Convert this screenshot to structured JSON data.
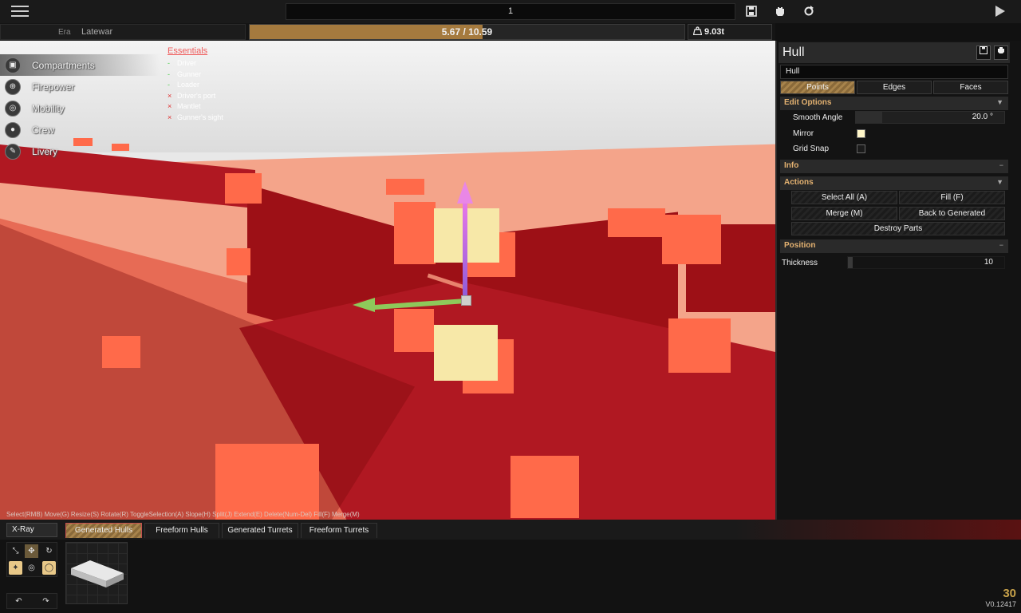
{
  "topbar": {
    "title_value": "1",
    "menu_icon": "hamburger-menu-icon",
    "save_icon": "save-icon",
    "hand_icon": "hand-grab-icon",
    "reset_icon": "refresh-icon",
    "play_icon": "play-icon"
  },
  "statusbar": {
    "era_label": "Era",
    "era_value": "Latewar",
    "cost_text": "5.67 / 10.59",
    "cost_used": 5.67,
    "cost_max": 10.59,
    "weight_icon": "weight-icon",
    "weight_text": "9.03t"
  },
  "nav": {
    "items": [
      {
        "label": "Compartments",
        "icon": "cube-icon",
        "active": true
      },
      {
        "label": "Firepower",
        "icon": "crosshair-icon",
        "active": false
      },
      {
        "label": "Mobility",
        "icon": "wheel-icon",
        "active": false
      },
      {
        "label": "Crew",
        "icon": "person-icon",
        "active": false
      },
      {
        "label": "Livery",
        "icon": "brush-icon",
        "active": false
      }
    ]
  },
  "essentials": {
    "title": "Essentials",
    "items": [
      {
        "label": "Driver",
        "ok": true
      },
      {
        "label": "Gunner",
        "ok": true
      },
      {
        "label": "Loader",
        "ok": true
      },
      {
        "label": "Driver's port",
        "ok": false
      },
      {
        "label": "Mantlet",
        "ok": false
      },
      {
        "label": "Gunner's sight",
        "ok": false
      }
    ]
  },
  "hint_text": "Select(RMB) Move(G) Resize(S) Rotate(R) ToggleSelection(A) Slope(H) Split(J) Extend(E) Delete(Num-Del) Fill(F) Merge(M)",
  "panel": {
    "title": "Hull",
    "name_value": "Hull",
    "tabs": [
      "Points",
      "Edges",
      "Faces"
    ],
    "edit_options": {
      "label": "Edit Options",
      "smooth_angle_label": "Smooth Angle",
      "smooth_angle_value": "20.0 °",
      "smooth_angle_fraction": 0.18,
      "mirror_label": "Mirror",
      "mirror_checked": true,
      "grid_snap_label": "Grid Snap",
      "grid_snap_checked": false
    },
    "info_label": "Info",
    "actions": {
      "label": "Actions",
      "select_all": "Select All (A)",
      "fill": "Fill (F)",
      "merge": "Merge (M)",
      "back_to_generated": "Back to Generated",
      "destroy_parts": "Destroy Parts"
    },
    "position": {
      "label": "Position",
      "thickness_label": "Thickness",
      "thickness_value": "10",
      "thickness_fraction": 0.02
    },
    "collapse_symbol": "−",
    "expand_symbol": "▼"
  },
  "bottom": {
    "xray_label": "X-Ray",
    "tabs": [
      "Generated Hulls",
      "Freeform Hulls",
      "Generated Turrets",
      "Freeform Turrets"
    ],
    "active_tab": 0,
    "fps": "30",
    "version": "V0.12417"
  }
}
